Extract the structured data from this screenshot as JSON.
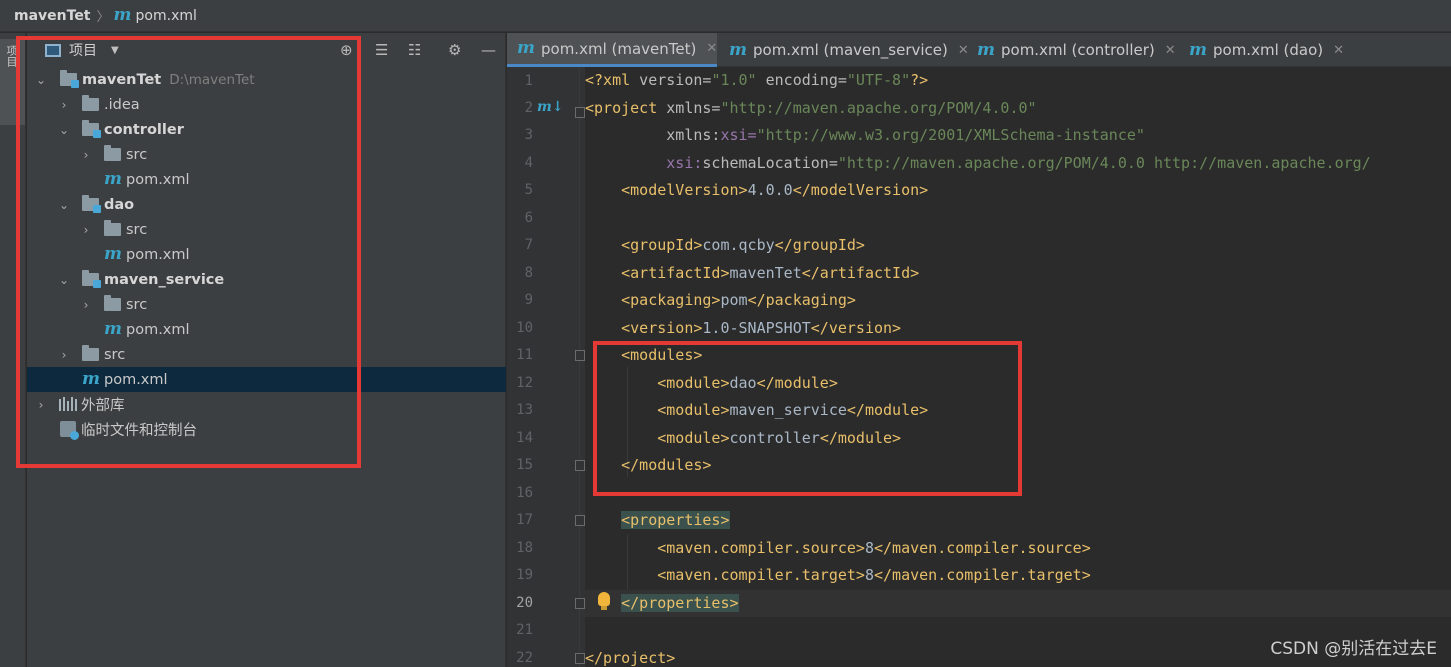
{
  "breadcrumb": {
    "root": "mavenTet",
    "file": "pom.xml"
  },
  "left_stripe": {
    "tab_label": "项目"
  },
  "project_panel": {
    "title": "项目",
    "tree": [
      {
        "label": "mavenTet",
        "path": "D:\\mavenTet"
      },
      {
        "label": ".idea"
      },
      {
        "label": "controller"
      },
      {
        "label": "src"
      },
      {
        "label": "pom.xml"
      },
      {
        "label": "dao"
      },
      {
        "label": "src"
      },
      {
        "label": "pom.xml"
      },
      {
        "label": "maven_service"
      },
      {
        "label": "src"
      },
      {
        "label": "pom.xml"
      },
      {
        "label": "src"
      },
      {
        "label": "pom.xml"
      },
      {
        "label": "外部库"
      },
      {
        "label": "临时文件和控制台"
      }
    ]
  },
  "tabs": [
    {
      "label": "pom.xml (mavenTet)",
      "close": "✕"
    },
    {
      "label": "pom.xml (maven_service)",
      "close": "✕"
    },
    {
      "label": "pom.xml (controller)",
      "close": "✕"
    },
    {
      "label": "pom.xml (dao)",
      "close": "✕"
    }
  ],
  "editor": {
    "line_numbers": [
      "1",
      "2",
      "3",
      "4",
      "5",
      "6",
      "7",
      "8",
      "9",
      "10",
      "11",
      "12",
      "13",
      "14",
      "15",
      "16",
      "17",
      "18",
      "19",
      "20",
      "21",
      "22"
    ],
    "current_line": "20",
    "lines": {
      "l1_tag_open": "<?xml",
      "l1_attr1": " version=",
      "l1_val1": "\"1.0\"",
      "l1_attr2": " encoding=",
      "l1_val2": "\"UTF-8\"",
      "l1_tag_close": "?>",
      "l2_tag": "<project",
      "l2_attr": " xmlns=",
      "l2_val": "\"http://maven.apache.org/POM/4.0.0\"",
      "l3_ns": "xmlns:",
      "l3_attr": "xsi=",
      "l3_val": "\"http://www.w3.org/2001/XMLSchema-instance\"",
      "l4_ns": "xsi:",
      "l4_attr": "schemaLocation=",
      "l4_val": "\"http://maven.apache.org/POM/4.0.0 http://maven.apache.org/",
      "l5_open": "<modelVersion>",
      "l5_text": "4.0.0",
      "l5_close": "</modelVersion>",
      "l7_open": "<groupId>",
      "l7_text": "com.qcby",
      "l7_close": "</groupId>",
      "l8_open": "<artifactId>",
      "l8_text": "mavenTet",
      "l8_close": "</artifactId>",
      "l9_open": "<packaging>",
      "l9_text": "pom",
      "l9_close": "</packaging>",
      "l10_open": "<version>",
      "l10_text": "1.0-SNAPSHOT",
      "l10_close": "</version>",
      "l11_open": "<modules>",
      "l12_open": "<module>",
      "l12_text": "dao",
      "l12_close": "</module>",
      "l13_open": "<module>",
      "l13_text": "maven_service",
      "l13_close": "</module>",
      "l14_open": "<module>",
      "l14_text": "controller",
      "l14_close": "</module>",
      "l15_close": "</modules>",
      "l17_open": "<properties>",
      "l18_open": "<maven.compiler.source>",
      "l18_text": "8",
      "l18_close": "</maven.compiler.source>",
      "l19_open": "<maven.compiler.target>",
      "l19_text": "8",
      "l19_close": "</maven.compiler.target>",
      "l20_close": "</properties>",
      "l22_close": "</project>"
    }
  },
  "watermark": "CSDN @别活在过去E",
  "colors": {
    "highlight_box": "#e53935",
    "tag": "#e8bf6a",
    "string": "#6a8759",
    "namespace": "#9876aa",
    "maven_icon": "#3ba4c9"
  }
}
